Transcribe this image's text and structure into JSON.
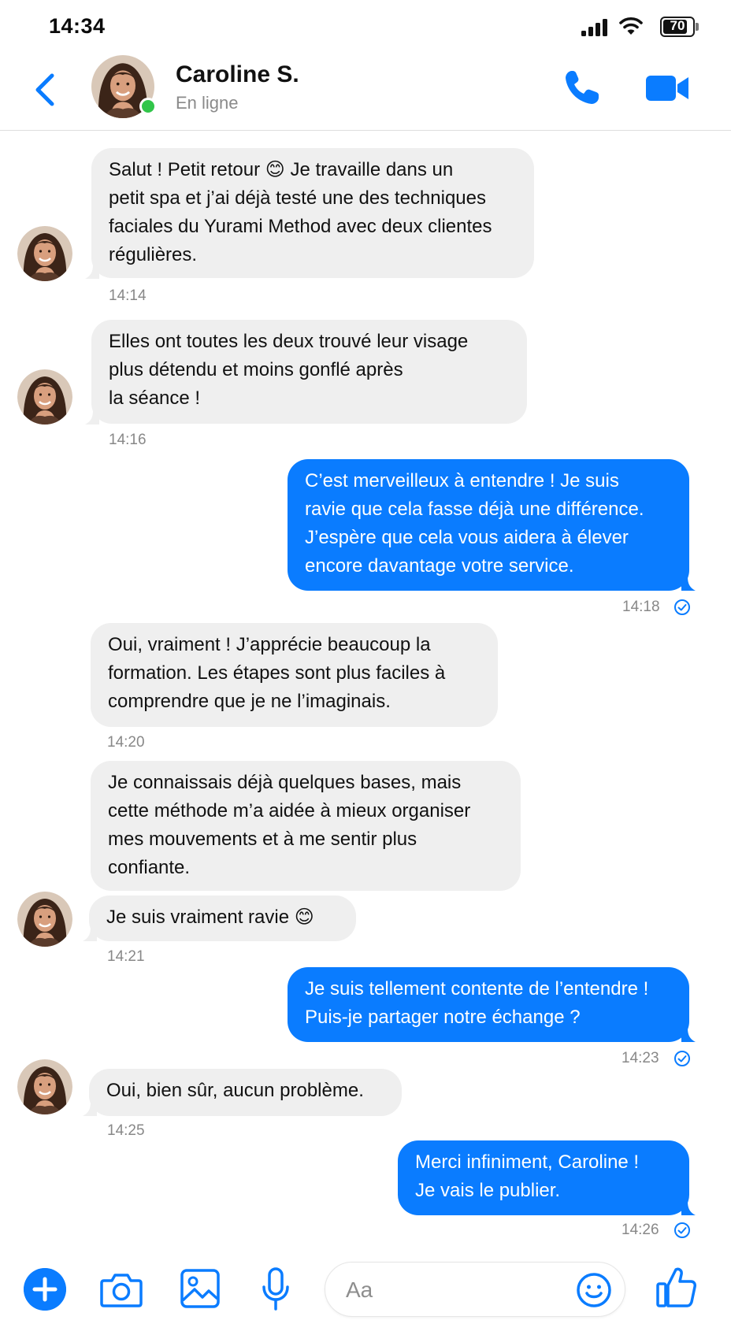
{
  "status_bar": {
    "time": "14:34",
    "battery": "70"
  },
  "header": {
    "contact_name": "Caroline S.",
    "contact_status": "En ligne",
    "back_icon": "chevron-left-icon",
    "call_icon": "phone-icon",
    "video_icon": "video-camera-icon"
  },
  "messages": [
    {
      "direction": "in",
      "text": "Salut ! Petit retour 😊 Je travaille dans un\npetit spa et j’ai déjà testé une des techniques\nfaciales du Yurami Method avec deux clientes\nrégulières.",
      "time": "14:14"
    },
    {
      "direction": "in",
      "text": "Elles ont toutes les deux trouvé leur visage\nplus détendu et moins gonflé après\nla séance !",
      "time": "14:16"
    },
    {
      "direction": "out",
      "text": "C’est merveilleux à entendre ! Je suis\nravie que cela fasse déjà une différence.\nJ’espère que cela vous aidera à élever\nencore davantage votre service.",
      "time": "14:18"
    },
    {
      "direction": "in",
      "text": "Oui, vraiment ! J’apprécie beaucoup la\nformation. Les étapes sont plus faciles à\ncomprendre que je ne l’imaginais.",
      "time": "14:20"
    },
    {
      "direction": "in",
      "text": "Je connaissais déjà quelques bases, mais\ncette méthode m’a aidée à mieux organiser\nmes mouvements et à me sentir plus\nconfiante.",
      "time": ""
    },
    {
      "direction": "in",
      "text": "Je suis vraiment ravie 😊",
      "time": "14:21"
    },
    {
      "direction": "out",
      "text": "Je suis tellement contente de l’entendre !\nPuis-je partager notre échange ?",
      "time": "14:23"
    },
    {
      "direction": "in",
      "text": "Oui, bien sûr, aucun problème.",
      "time": "14:25"
    },
    {
      "direction": "out",
      "text": "Merci infiniment, Caroline !\nJe vais le publier.",
      "time": "14:26"
    }
  ],
  "composer": {
    "placeholder": "Aa",
    "icons": [
      "plus-icon",
      "camera-icon",
      "image-icon",
      "microphone-icon",
      "smiley-icon",
      "thumbs-up-icon"
    ]
  },
  "colors": {
    "accent": "#0a7cff",
    "incoming_bubble": "#efefef",
    "online": "#31c54a"
  }
}
